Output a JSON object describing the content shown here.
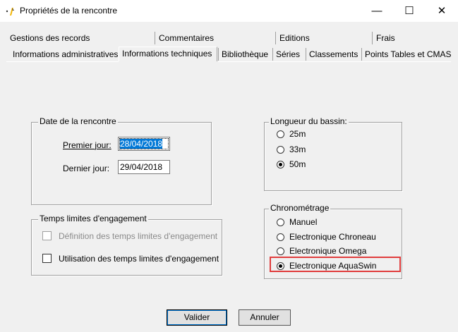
{
  "window": {
    "title": "Propriétés de la rencontre",
    "minimize_glyph": "—",
    "maximize_glyph": "☐",
    "close_glyph": "✕"
  },
  "tabs": {
    "row1": [
      "Gestions des records",
      "Commentaires",
      "Editions",
      "Frais"
    ],
    "row2": [
      "Informations administratives",
      "Informations techniques",
      "Bibliothèque",
      "Séries",
      "Classements",
      "Points Tables et CMAS"
    ],
    "active": "Informations techniques"
  },
  "date_group": {
    "title": "Date de la rencontre",
    "first_day_label": "Premier jour:",
    "first_day_value": "28/04/2018",
    "last_day_label": "Dernier jour:",
    "last_day_value": "29/04/2018"
  },
  "pool_group": {
    "title": "Longueur du bassin:",
    "options": [
      "25m",
      "33m",
      "50m"
    ],
    "selected": "50m"
  },
  "limits_group": {
    "title": "Temps limites d'engagement",
    "definition_label": "Définition des temps limites d'engagement",
    "usage_label": "Utilisation des temps limites d'engagement"
  },
  "timing_group": {
    "title": "Chronométrage",
    "options": [
      "Manuel",
      "Electronique Chroneau",
      "Electronique Omega",
      "Electronique AquaSwin"
    ],
    "selected": "Electronique AquaSwin",
    "highlight_color": "#e03c3c"
  },
  "buttons": {
    "validate": "Valider",
    "cancel": "Annuler"
  }
}
